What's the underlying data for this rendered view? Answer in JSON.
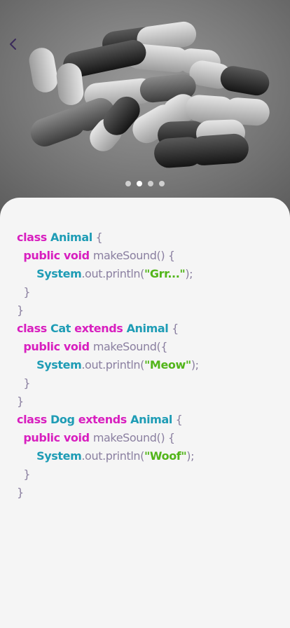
{
  "header": {
    "back_icon": "chevron-left-icon"
  },
  "carousel": {
    "total": 4,
    "active_index": 1
  },
  "code": {
    "lines": [
      [
        {
          "c": "kw",
          "t": "class "
        },
        {
          "c": "type",
          "t": "Animal"
        },
        {
          "c": "pl",
          "t": " {"
        }
      ],
      [
        {
          "c": "pl",
          "t": "  "
        },
        {
          "c": "kw",
          "t": "public void "
        },
        {
          "c": "pl",
          "t": "makeSound() {"
        }
      ],
      [
        {
          "c": "pl",
          "t": "      "
        },
        {
          "c": "sys",
          "t": "System"
        },
        {
          "c": "pl",
          "t": ".out.println("
        },
        {
          "c": "str",
          "t": "\"Grr...\""
        },
        {
          "c": "pl",
          "t": ");"
        }
      ],
      [
        {
          "c": "pl",
          "t": "  }"
        }
      ],
      [
        {
          "c": "pl",
          "t": "}"
        }
      ],
      [
        {
          "c": "kw",
          "t": "class "
        },
        {
          "c": "type",
          "t": "Cat "
        },
        {
          "c": "kw",
          "t": "extends "
        },
        {
          "c": "type",
          "t": "Animal"
        },
        {
          "c": "pl",
          "t": " {"
        }
      ],
      [
        {
          "c": "pl",
          "t": "  "
        },
        {
          "c": "kw",
          "t": "public void "
        },
        {
          "c": "pl",
          "t": "makeSound({"
        }
      ],
      [
        {
          "c": "pl",
          "t": "      "
        },
        {
          "c": "sys",
          "t": "System"
        },
        {
          "c": "pl",
          "t": ".out.println("
        },
        {
          "c": "str",
          "t": "\"Meow\""
        },
        {
          "c": "pl",
          "t": ");"
        }
      ],
      [
        {
          "c": "pl",
          "t": "  }"
        }
      ],
      [
        {
          "c": "pl",
          "t": "}"
        }
      ],
      [
        {
          "c": "kw",
          "t": "class "
        },
        {
          "c": "type",
          "t": "Dog "
        },
        {
          "c": "kw",
          "t": "extends "
        },
        {
          "c": "type",
          "t": "Animal"
        },
        {
          "c": "pl",
          "t": " {"
        }
      ],
      [
        {
          "c": "pl",
          "t": "  "
        },
        {
          "c": "kw",
          "t": "public void "
        },
        {
          "c": "pl",
          "t": "makeSound() {"
        }
      ],
      [
        {
          "c": "pl",
          "t": "      "
        },
        {
          "c": "sys",
          "t": "System"
        },
        {
          "c": "pl",
          "t": ".out.println("
        },
        {
          "c": "str",
          "t": "\"Woof\""
        },
        {
          "c": "pl",
          "t": ");"
        }
      ],
      [
        {
          "c": "pl",
          "t": "  }"
        }
      ],
      [
        {
          "c": "pl",
          "t": "}"
        }
      ]
    ]
  },
  "colors": {
    "keyword": "#d81fbf",
    "type": "#1e9cb5",
    "plain": "#8a7fa0",
    "string": "#52b51a",
    "sheet": "#f5f5f5"
  }
}
